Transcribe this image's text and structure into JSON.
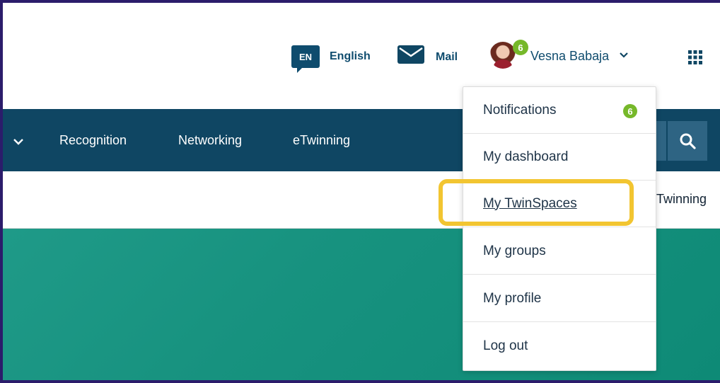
{
  "header": {
    "language_code": "EN",
    "language_label": "English",
    "mail_label": "Mail",
    "user_name": "Vesna Babaja",
    "notification_count": "6"
  },
  "nav": {
    "items": [
      {
        "label": "Recognition"
      },
      {
        "label": "Networking"
      },
      {
        "label": "eTwinning"
      }
    ]
  },
  "subnav": {
    "item": "Twinning"
  },
  "dropdown": {
    "items": [
      {
        "label": "Notifications",
        "badge": "6"
      },
      {
        "label": "My dashboard"
      },
      {
        "label": "My TwinSpaces"
      },
      {
        "label": "My groups"
      },
      {
        "label": "My profile"
      },
      {
        "label": "Log out"
      }
    ]
  },
  "colors": {
    "brand_dark": "#0f4663",
    "badge_green": "#76b82a",
    "highlight_yellow": "#f2c531",
    "hero_teal": "#17927f"
  }
}
